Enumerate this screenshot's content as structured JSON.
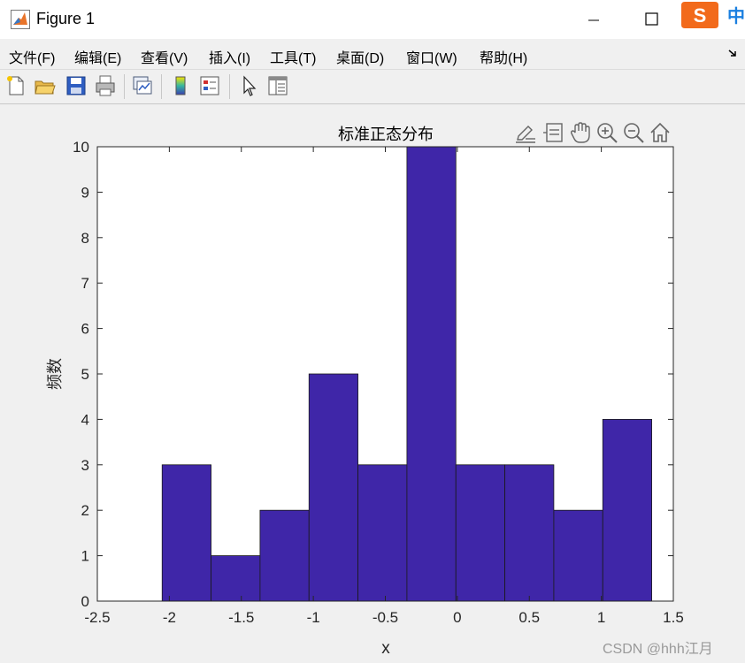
{
  "window": {
    "title": "Figure 1",
    "ime_label": "中"
  },
  "menu": {
    "items": [
      {
        "label": "文件(F)"
      },
      {
        "label": "编辑(E)"
      },
      {
        "label": "查看(V)"
      },
      {
        "label": "插入(I)"
      },
      {
        "label": "工具(T)"
      },
      {
        "label": "桌面(D)"
      },
      {
        "label": "窗口(W)"
      },
      {
        "label": "帮助(H)"
      }
    ]
  },
  "toolbar": {
    "icons": [
      "new-figure-icon",
      "open-file-icon",
      "save-icon",
      "print-icon",
      "link-plot-icon",
      "insert-colorbar-icon",
      "insert-legend-icon",
      "edit-plot-icon",
      "property-inspector-icon"
    ]
  },
  "axes_toolbar": {
    "icons": [
      "brush-icon",
      "data-tips-icon",
      "pan-icon",
      "zoom-in-icon",
      "zoom-out-icon",
      "home-icon"
    ]
  },
  "chart_data": {
    "type": "bar",
    "title": "标准正态分布",
    "xlabel": "x",
    "ylabel": "频数",
    "xlim": [
      -2.5,
      1.5
    ],
    "ylim": [
      0,
      10
    ],
    "xticks": [
      "-2.5",
      "-2",
      "-1.5",
      "-1",
      "-0.5",
      "0",
      "0.5",
      "1",
      "1.5"
    ],
    "yticks": [
      "0",
      "1",
      "2",
      "3",
      "4",
      "5",
      "6",
      "7",
      "8",
      "9",
      "10"
    ],
    "bin_edges": [
      -2.05,
      -1.71,
      -1.37,
      -1.03,
      -0.69,
      -0.35,
      -0.01,
      0.33,
      0.67,
      1.01,
      1.35
    ],
    "values": [
      3,
      1,
      2,
      5,
      3,
      10,
      3,
      3,
      2,
      4
    ],
    "bar_color": "#3f26a8",
    "edge_color": "#1a1a1a",
    "grid": false
  },
  "watermark": "CSDN @hhh江月"
}
